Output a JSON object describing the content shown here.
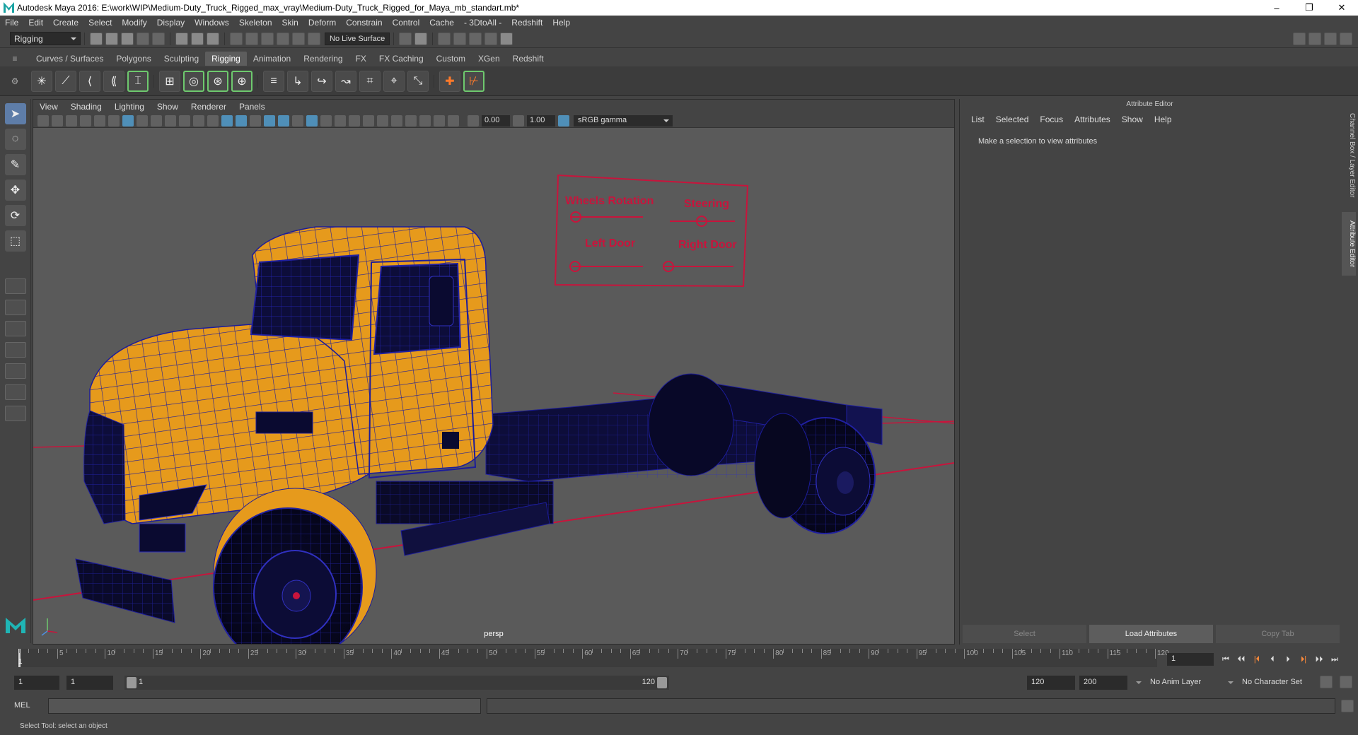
{
  "window": {
    "title": "Autodesk Maya 2016: E:\\work\\WIP\\Medium-Duty_Truck_Rigged_max_vray\\Medium-Duty_Truck_Rigged_for_Maya_mb_standart.mb*",
    "min": "–",
    "max": "❐",
    "close": "✕"
  },
  "menu": [
    "File",
    "Edit",
    "Create",
    "Select",
    "Modify",
    "Display",
    "Windows",
    "Skeleton",
    "Skin",
    "Deform",
    "Constrain",
    "Control",
    "Cache",
    "- 3DtoAll -",
    "Redshift",
    "Help"
  ],
  "status": {
    "mode": "Rigging",
    "live_surface": "No Live Surface"
  },
  "shelf_tabs": [
    "Curves / Surfaces",
    "Polygons",
    "Sculpting",
    "Rigging",
    "Animation",
    "Rendering",
    "FX",
    "FX Caching",
    "Custom",
    "XGen",
    "Redshift"
  ],
  "shelf_active": "Rigging",
  "shelf_icons": [
    "✳",
    "⟋",
    "⟨",
    "⟪",
    "⌶",
    "⊞",
    "◎",
    "⊛",
    "⊕",
    "≡",
    "↳",
    "↪",
    "↝",
    "⌗",
    "⌖",
    "⤡",
    "✚",
    "⊬"
  ],
  "viewport": {
    "menu": [
      "View",
      "Shading",
      "Lighting",
      "Show",
      "Renderer",
      "Panels"
    ],
    "near": "0.00",
    "far": "1.00",
    "color_mgmt": "sRGB gamma",
    "camera": "persp",
    "controls": {
      "wheels": "Wheels Rotation",
      "steering": "Steering",
      "left_door": "Left Door",
      "right_door": "Right Door"
    }
  },
  "attr_editor": {
    "title": "Attribute Editor",
    "menu": [
      "List",
      "Selected",
      "Focus",
      "Attributes",
      "Show",
      "Help"
    ],
    "message": "Make a selection to view attributes",
    "buttons": {
      "select": "Select",
      "load": "Load Attributes",
      "copy": "Copy Tab"
    }
  },
  "side_tabs": {
    "channel": "Channel Box / Layer Editor",
    "attr": "Attribute Editor"
  },
  "timeline": {
    "ticks": [
      5,
      10,
      15,
      20,
      25,
      30,
      35,
      40,
      45,
      50,
      55,
      60,
      65,
      70,
      75,
      80,
      85,
      90,
      95,
      100,
      105,
      110,
      115,
      120
    ],
    "current": "1",
    "current_frame": "1",
    "start": 1,
    "end": 120,
    "playback": [
      "⏮",
      "⏴⏴",
      "|⏴",
      "⏴",
      "⏵",
      "⏵|",
      "⏵⏵",
      "⏭"
    ]
  },
  "range": {
    "start": "1",
    "current": "1",
    "slider_start": "1",
    "slider_end": "120",
    "end": "120",
    "max": "200",
    "anim_layer": "No Anim Layer",
    "char_set": "No Character Set"
  },
  "command": {
    "label": "MEL"
  },
  "help": "Select Tool: select an object",
  "colors": {
    "truck": "#e69a1c",
    "wire": "#1c1c9a",
    "control": "#c8143c"
  }
}
